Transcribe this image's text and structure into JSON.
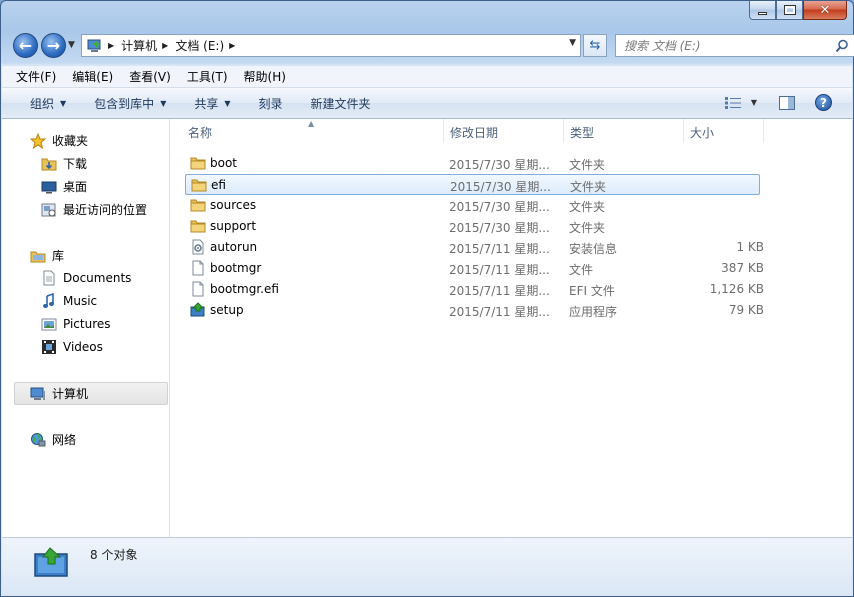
{
  "window": {
    "caption": {
      "min": "minimize",
      "max": "maximize",
      "close": "✕"
    }
  },
  "address": {
    "crumbs": [
      "计算机",
      "文档 (E:)"
    ],
    "search_placeholder": "搜索 文档 (E:)"
  },
  "menu": [
    "文件(F)",
    "编辑(E)",
    "查看(V)",
    "工具(T)",
    "帮助(H)"
  ],
  "commands": [
    {
      "label": "组织",
      "dropdown": true
    },
    {
      "label": "包含到库中",
      "dropdown": true
    },
    {
      "label": "共享",
      "dropdown": true
    },
    {
      "label": "刻录",
      "dropdown": false
    },
    {
      "label": "新建文件夹",
      "dropdown": false
    }
  ],
  "nav": {
    "favorites": {
      "label": "收藏夹",
      "items": [
        "下载",
        "桌面",
        "最近访问的位置"
      ]
    },
    "libraries": {
      "label": "库",
      "items": [
        "Documents",
        "Music",
        "Pictures",
        "Videos"
      ]
    },
    "computer": "计算机",
    "network": "网络"
  },
  "columns": {
    "name": "名称",
    "date": "修改日期",
    "type": "类型",
    "size": "大小"
  },
  "files": [
    {
      "name": "boot",
      "date": "2015/7/30 星期...",
      "type": "文件夹",
      "size": "",
      "icon": "folder-icon"
    },
    {
      "name": "efi",
      "date": "2015/7/30 星期...",
      "type": "文件夹",
      "size": "",
      "icon": "folder-icon",
      "selected": true
    },
    {
      "name": "sources",
      "date": "2015/7/30 星期...",
      "type": "文件夹",
      "size": "",
      "icon": "folder-icon"
    },
    {
      "name": "support",
      "date": "2015/7/30 星期...",
      "type": "文件夹",
      "size": "",
      "icon": "folder-icon"
    },
    {
      "name": "autorun",
      "date": "2015/7/11 星期...",
      "type": "安装信息",
      "size": "1 KB",
      "icon": "setup-info-icon"
    },
    {
      "name": "bootmgr",
      "date": "2015/7/11 星期...",
      "type": "文件",
      "size": "387 KB",
      "icon": "file-icon"
    },
    {
      "name": "bootmgr.efi",
      "date": "2015/7/11 星期...",
      "type": "EFI 文件",
      "size": "1,126 KB",
      "icon": "file-icon"
    },
    {
      "name": "setup",
      "date": "2015/7/11 星期...",
      "type": "应用程序",
      "size": "79 KB",
      "icon": "setup-app-icon"
    }
  ],
  "details": {
    "count": "8 个对象"
  },
  "colors": {
    "selection": "#dcebfb",
    "selection_border": "#84acdd",
    "folder": "#e8c15a"
  }
}
